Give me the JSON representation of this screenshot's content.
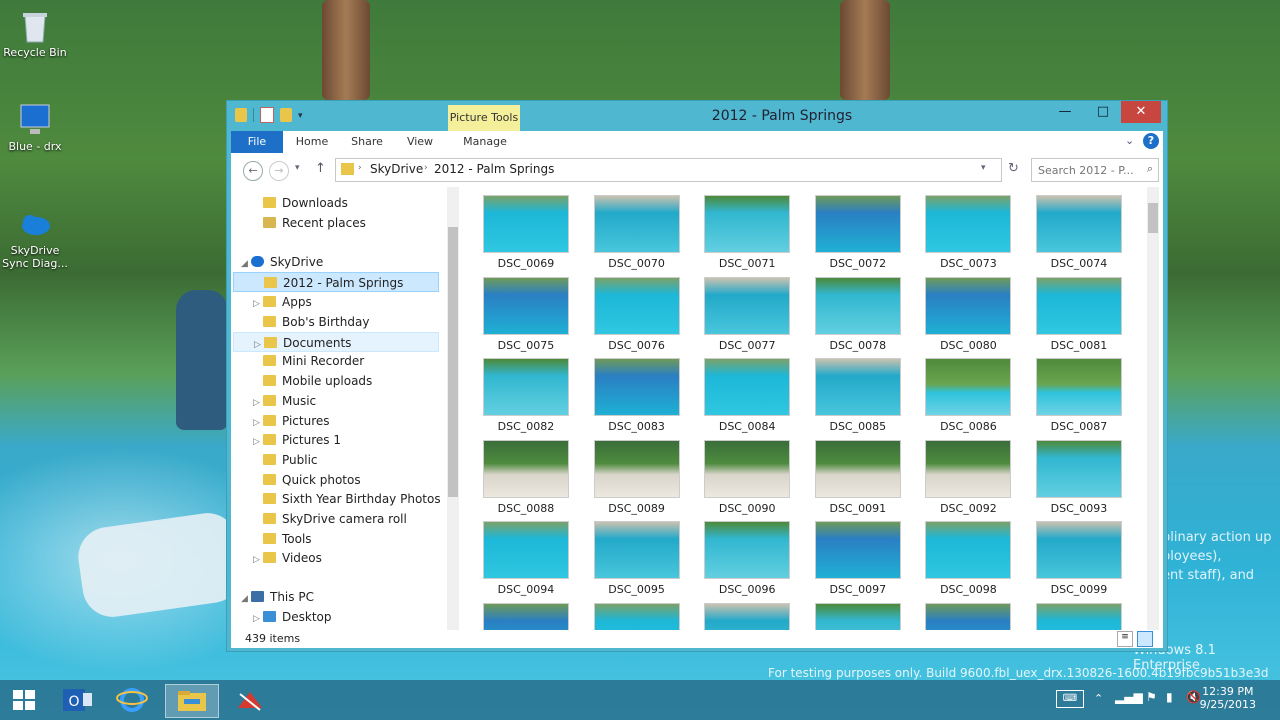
{
  "desktop": {
    "icons": [
      {
        "label": "Recycle Bin",
        "icon": "recycle-bin-icon"
      },
      {
        "label": "Blue - drx",
        "icon": "computer-icon"
      },
      {
        "label": "SkyDrive Sync Diag...",
        "icon": "skydrive-icon"
      }
    ],
    "watermark": {
      "line1": "plinary action up",
      "line2": "ployees),",
      "line3": "ent staff), and",
      "line4": "Windows 8.1 Enterprise",
      "line5": "For testing purposes only. Build 9600.fbl_uex_drx.130826-1600.4b19fbc9b51b3e3d"
    }
  },
  "window": {
    "title": "2012 - Palm Springs",
    "context_tab": "Picture Tools",
    "ribbon_tabs": [
      "File",
      "Home",
      "Share",
      "View",
      "Manage"
    ],
    "breadcrumb": [
      "SkyDrive",
      "2012 - Palm Springs"
    ],
    "search_placeholder": "Search 2012 - P...",
    "nav": [
      {
        "label": "Downloads",
        "level": 1,
        "expandable": false
      },
      {
        "label": "Recent places",
        "level": 1,
        "expandable": false
      },
      {
        "label": "SkyDrive",
        "level": 0,
        "expandable": true,
        "expanded": true
      },
      {
        "label": "2012 - Palm Springs",
        "level": 1,
        "expandable": false,
        "selected": true
      },
      {
        "label": "Apps",
        "level": 1,
        "expandable": true
      },
      {
        "label": "Bob's Birthday",
        "level": 1,
        "expandable": false
      },
      {
        "label": "Documents",
        "level": 1,
        "expandable": true,
        "hover": true
      },
      {
        "label": "Mini Recorder",
        "level": 1,
        "expandable": false
      },
      {
        "label": "Mobile uploads",
        "level": 1,
        "expandable": false
      },
      {
        "label": "Music",
        "level": 1,
        "expandable": true
      },
      {
        "label": "Pictures",
        "level": 1,
        "expandable": true
      },
      {
        "label": "Pictures 1",
        "level": 1,
        "expandable": true
      },
      {
        "label": "Public",
        "level": 1,
        "expandable": false
      },
      {
        "label": "Quick photos",
        "level": 1,
        "expandable": false
      },
      {
        "label": "Sixth Year Birthday Photos",
        "level": 1,
        "expandable": false
      },
      {
        "label": "SkyDrive camera roll",
        "level": 1,
        "expandable": false
      },
      {
        "label": "Tools",
        "level": 1,
        "expandable": false
      },
      {
        "label": "Videos",
        "level": 1,
        "expandable": true
      },
      {
        "label": "This PC",
        "level": 0,
        "expandable": true,
        "expanded": true
      },
      {
        "label": "Desktop",
        "level": 1,
        "expandable": true
      }
    ],
    "files": [
      "DSC_0069",
      "DSC_0070",
      "DSC_0071",
      "DSC_0072",
      "DSC_0073",
      "DSC_0074",
      "DSC_0075",
      "DSC_0076",
      "DSC_0077",
      "DSC_0078",
      "DSC_0080",
      "DSC_0081",
      "DSC_0082",
      "DSC_0083",
      "DSC_0084",
      "DSC_0085",
      "DSC_0086",
      "DSC_0087",
      "DSC_0088",
      "DSC_0089",
      "DSC_0090",
      "DSC_0091",
      "DSC_0092",
      "DSC_0093",
      "DSC_0094",
      "DSC_0095",
      "DSC_0096",
      "DSC_0097",
      "DSC_0098",
      "DSC_0099",
      "",
      "",
      "",
      "",
      "",
      ""
    ],
    "status": "439 items"
  },
  "taskbar": {
    "time": "12:39 PM",
    "date": "9/25/2013"
  },
  "colors": {
    "window_frame": "#4fb7cf",
    "file_tab": "#1d6fc7",
    "selection": "#cce8ff",
    "close_button": "#c7463f"
  }
}
